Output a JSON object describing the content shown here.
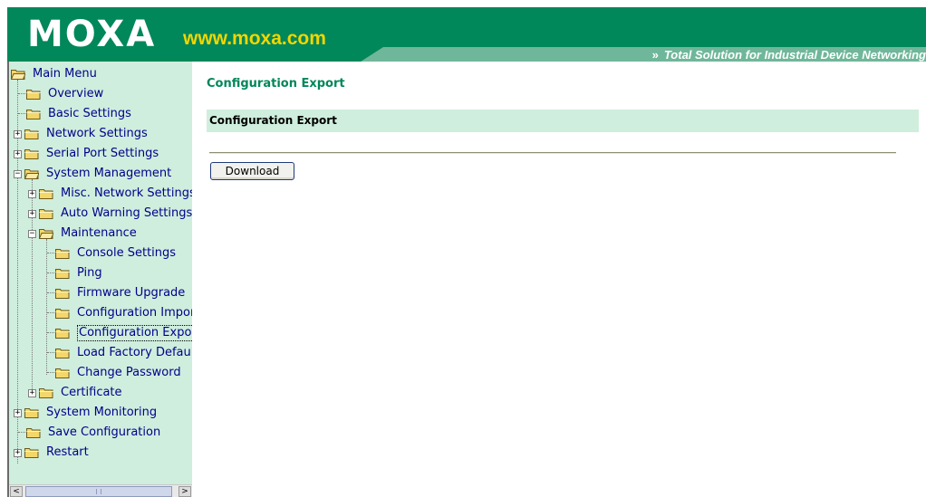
{
  "header": {
    "logo": "MOXA",
    "url": "www.moxa.com",
    "tagline": "Total Solution for Industrial Device Networking",
    "brand_color": "#00875a",
    "url_color": "#f2d600"
  },
  "menu": {
    "root": "Main Menu",
    "items": {
      "overview": "Overview",
      "basic_settings": "Basic Settings",
      "network_settings": "Network Settings",
      "serial_port_settings": "Serial Port Settings",
      "system_management": "System Management",
      "misc_network_settings": "Misc. Network Settings",
      "auto_warning_settings": "Auto Warning Settings",
      "maintenance": "Maintenance",
      "console_settings": "Console Settings",
      "ping": "Ping",
      "firmware_upgrade": "Firmware Upgrade",
      "configuration_import": "Configuration Impor",
      "configuration_export": "Configuration Export",
      "load_factory_default": "Load Factory Default",
      "change_password": "Change Password",
      "certificate": "Certificate",
      "system_monitoring": "System Monitoring",
      "save_configuration": "Save Configuration",
      "restart": "Restart"
    },
    "selected": "configuration_export",
    "menu_bg": "#cfeedd"
  },
  "main": {
    "title": "Configuration Export",
    "section_title": "Configuration Export",
    "download_label": "Download"
  },
  "icons": {
    "expand": "+",
    "collapse": "−",
    "scroll_left": "<",
    "scroll_right": ">",
    "tagline_chevron": "»"
  }
}
